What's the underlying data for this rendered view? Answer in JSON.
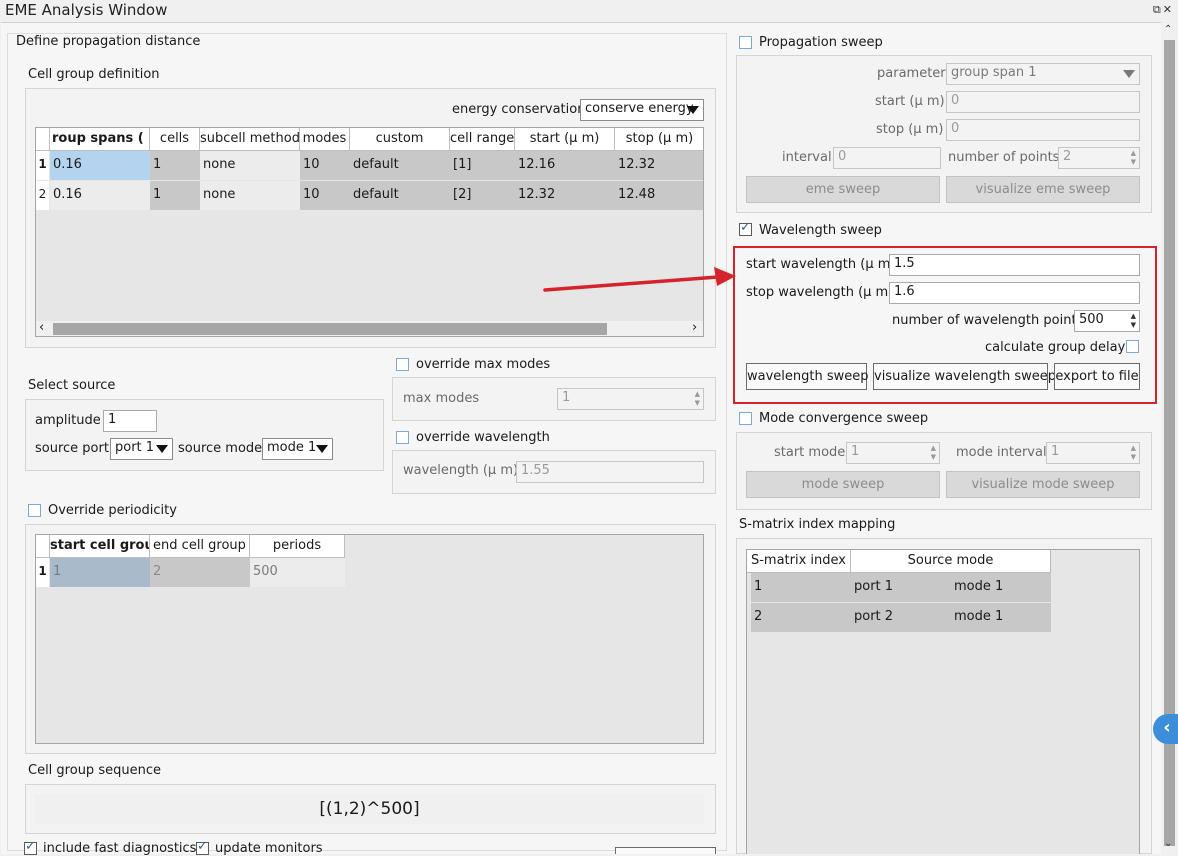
{
  "window": {
    "title": "EME Analysis Window",
    "controls": "⧉✕"
  },
  "left": {
    "define_propagation_label": "Define propagation distance",
    "cell_group_definition": {
      "label": "Cell group definition",
      "energy_conservation_label": "energy conservation",
      "energy_conservation_value": "conserve energy",
      "columns": [
        "roup spans ( μ m",
        "cells",
        "subcell method",
        "modes",
        "custom",
        "cell range",
        "start (μ m)",
        "stop (μ m)"
      ],
      "rows": [
        {
          "num": "1",
          "cells": [
            "0.16",
            "1",
            "none",
            "10",
            "default",
            "[1]",
            "12.16",
            "12.32"
          ]
        },
        {
          "num": "2",
          "cells": [
            "0.16",
            "1",
            "none",
            "10",
            "default",
            "[2]",
            "12.32",
            "12.48"
          ]
        }
      ]
    },
    "select_source": {
      "label": "Select source",
      "amplitude_label": "amplitude",
      "amplitude_value": "1",
      "source_port_label": "source port",
      "source_port_value": "port 1",
      "source_mode_label": "source mode",
      "source_mode_value": "mode 1"
    },
    "override_max_modes": {
      "label": "override max modes",
      "checked": false,
      "max_modes_label": "max modes",
      "max_modes_value": "1"
    },
    "override_wavelength": {
      "label": "override wavelength",
      "checked": false,
      "wavelength_label": "wavelength (μ m)",
      "wavelength_value": "1.55"
    },
    "override_periodicity": {
      "label": "Override periodicity",
      "checked": false,
      "columns": [
        "start cell group",
        "end cell group",
        "periods"
      ],
      "rows": [
        {
          "num": "1",
          "cells": [
            "1",
            "2",
            "500"
          ]
        }
      ]
    },
    "cell_group_sequence": {
      "label": "Cell group sequence",
      "value": "[(1,2)^500]"
    },
    "include_fast_diagnostics": {
      "label": "include fast diagnostics",
      "checked": true
    },
    "update_monitors": {
      "label": "update monitors",
      "checked": true
    }
  },
  "right": {
    "propagation_sweep": {
      "label": "Propagation sweep",
      "checked": false,
      "parameter_label": "parameter",
      "parameter_value": "group span 1",
      "start_label": "start (μ m)",
      "start_value": "0",
      "stop_label": "stop (μ m)",
      "stop_value": "0",
      "interval_label": "interval",
      "interval_value": "0",
      "num_points_label": "number of points",
      "num_points_value": "2",
      "eme_sweep_button": "eme sweep",
      "visualize_eme_sweep_button": "visualize eme sweep"
    },
    "wavelength_sweep": {
      "label": "Wavelength sweep",
      "checked": true,
      "start_label": "start wavelength (μ m)",
      "start_value": "1.5",
      "stop_label": "stop wavelength (μ m)",
      "stop_value": "1.6",
      "num_points_label": "number of wavelength points",
      "num_points_value": "500",
      "group_delays_label": "calculate group delays",
      "group_delays_checked": false,
      "wavelength_sweep_button": "wavelength sweep",
      "visualize_button": "visualize wavelength sweep",
      "export_button": "export to file"
    },
    "mode_convergence_sweep": {
      "label": "Mode convergence sweep",
      "checked": false,
      "start_mode_label": "start mode",
      "start_mode_value": "1",
      "mode_interval_label": "mode interval",
      "mode_interval_value": "1",
      "mode_sweep_button": "mode sweep",
      "visualize_mode_sweep_button": "visualize mode sweep"
    },
    "smatrix_mapping": {
      "label": "S-matrix index mapping",
      "columns": [
        "S-matrix index",
        "Source mode"
      ],
      "rows": [
        {
          "cells": [
            "1",
            "port 1",
            "mode 1"
          ]
        },
        {
          "cells": [
            "2",
            "port 2",
            "mode 1"
          ]
        }
      ]
    }
  },
  "colors": {
    "annotation_red": "#d6222a",
    "selected_cell": "#b3d3ee",
    "accent_blue": "#3c8edb"
  }
}
